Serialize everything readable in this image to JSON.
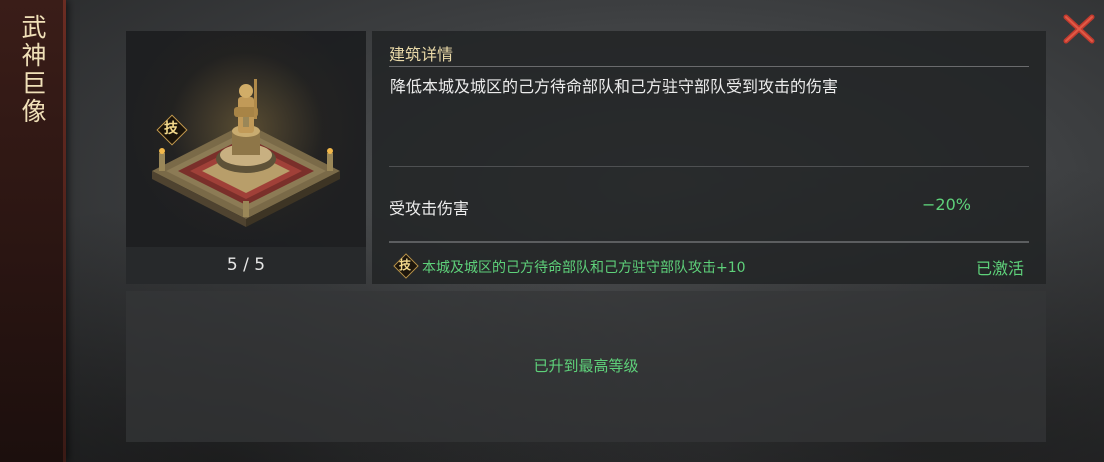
{
  "banner": {
    "title": "武神巨像"
  },
  "building": {
    "level": "5 / 5",
    "tech_badge": "技"
  },
  "details": {
    "title": "建筑详情",
    "description": "降低本城及城区的己方待命部队和己方驻守部队受到攻击的伤害",
    "stat_label": "受攻击伤害",
    "stat_value": "−20%",
    "skill_badge": "技",
    "skill_text": "本城及城区的己方待命部队和己方驻守部队攻击+10",
    "skill_status": "已激活"
  },
  "upgrade": {
    "message": "已升到最高等级"
  },
  "colors": {
    "accent_green": "#5ed17a",
    "close_red": "#c0392b",
    "title_gold": "#e9d9a8"
  },
  "icons": {
    "close": "close-icon",
    "building": "colossus-statue-icon"
  }
}
